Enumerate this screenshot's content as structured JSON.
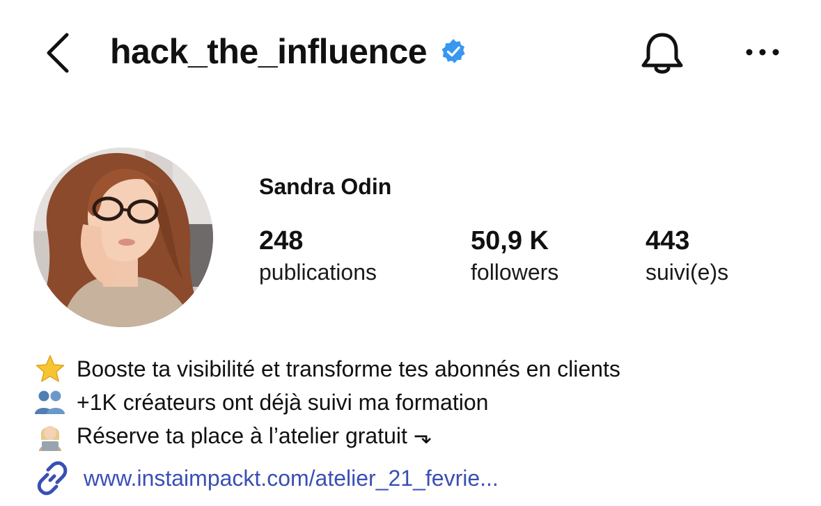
{
  "header": {
    "username": "hack_the_influence",
    "back_icon": "chevron-left-icon",
    "verified_icon": "verified-badge-icon",
    "bell_icon": "bell-icon",
    "more_icon": "more-horizontal-icon",
    "verified_color": "#3897f0"
  },
  "profile": {
    "display_name": "Sandra Odin",
    "avatar": "profile-photo"
  },
  "stats": [
    {
      "value": "248",
      "label": "publications"
    },
    {
      "value": "50,9 K",
      "label": "followers"
    },
    {
      "value": "443",
      "label": "suivi(e)s"
    }
  ],
  "bio": {
    "lines": [
      {
        "icon": "star-icon",
        "text": "Booste ta visibilité et transforme tes abonnés en clients"
      },
      {
        "icon": "people-icon",
        "text": "+1K créateurs ont déjà suivi ma formation"
      },
      {
        "icon": "woman-laptop-icon",
        "text": "Réserve ta place à l’atelier gratuit ⬎"
      }
    ]
  },
  "link": {
    "icon": "link-icon",
    "text": "www.instaimpackt.com/atelier_21_fevrie...",
    "color": "#3a4fb5"
  }
}
